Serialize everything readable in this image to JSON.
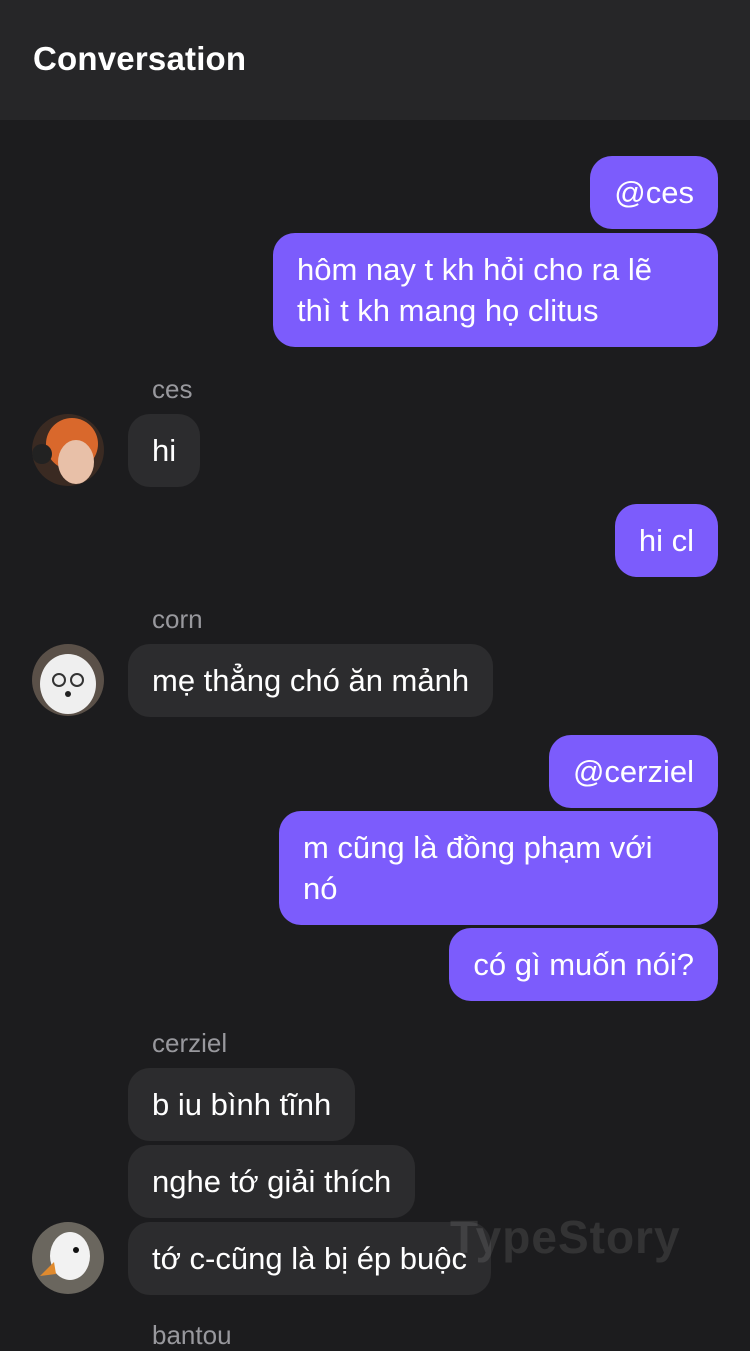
{
  "header": {
    "title": "Conversation"
  },
  "messages": [
    {
      "text": "@ces"
    },
    {
      "text": "hôm nay t kh hỏi cho ra lẽ\nthì t kh mang họ clitus"
    },
    {
      "sender": "ces",
      "text": "hi"
    },
    {
      "text": "hi cl"
    },
    {
      "sender": "corn",
      "text": "mẹ thẳng chó ăn mảnh"
    },
    {
      "text": "@cerziel"
    },
    {
      "text": "m cũng là đồng phạm với\nnó"
    },
    {
      "text": "có gì muốn nói?"
    },
    {
      "sender": "cerziel",
      "text": "b iu bình tĩnh"
    },
    {
      "text": "nghe tớ giải thích"
    },
    {
      "text": "tớ c-cũng là bị ép buộc"
    },
    {
      "sender": "bantou"
    }
  ],
  "watermark": "TypeStory",
  "colors": {
    "outgoing": "#7c5cfc",
    "incoming": "#2c2c2e",
    "background": "#1c1c1e"
  }
}
